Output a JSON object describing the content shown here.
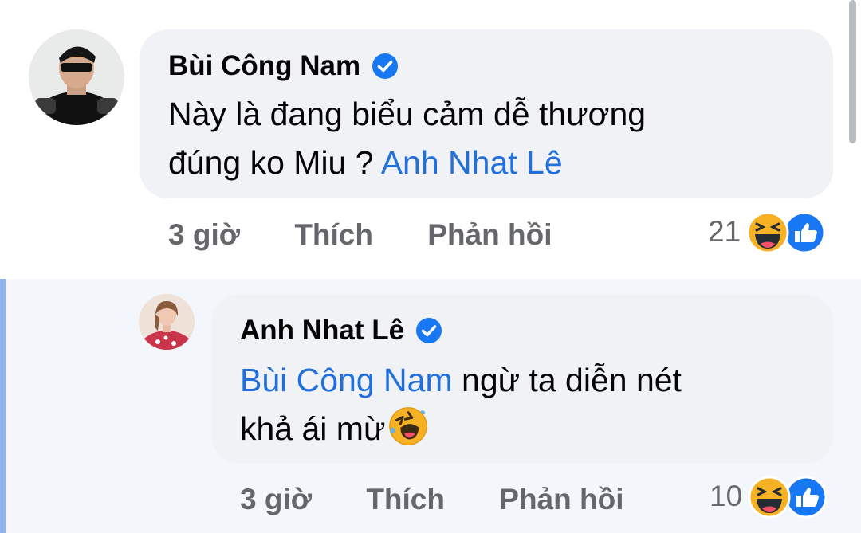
{
  "comments": [
    {
      "author": "Bùi Công Nam",
      "verified": true,
      "text_line1": "Này là đang biểu cảm dễ thương",
      "text_line2_prefix": "đúng ko Miu ? ",
      "text_line2_mention": "Anh Nhat Lê",
      "time": "3 giờ",
      "like_label": "Thích",
      "reply_label": "Phản hồi",
      "reaction_count": "21",
      "reaction_icons": [
        "haha-icon",
        "like-icon"
      ]
    },
    {
      "author": "Anh Nhat Lê",
      "verified": true,
      "text_line1_mention": "Bùi Công Nam",
      "text_line1_rest": " ngừ ta diễn nét",
      "text_line2": "khả ái mừ",
      "inline_emoji": "rolling-laughing-icon",
      "time": "3 giờ",
      "like_label": "Thích",
      "reply_label": "Phản hồi",
      "reaction_count": "10",
      "reaction_icons": [
        "haha-icon",
        "like-icon"
      ]
    }
  ],
  "colors": {
    "bubble": "#f0f2f5",
    "mention": "#216fdb",
    "meta": "#65676b",
    "verified": "#1877f2",
    "reply_rail": "#8fb3f3"
  }
}
